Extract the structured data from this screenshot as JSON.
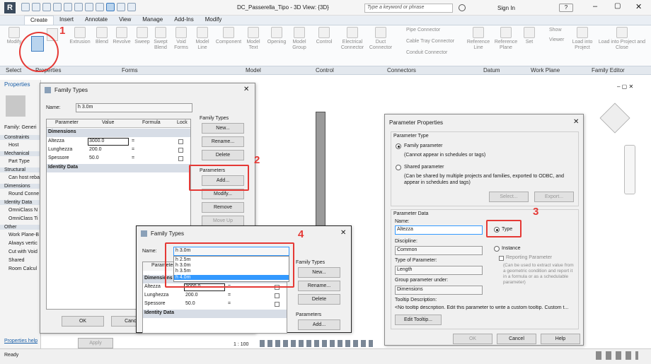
{
  "app": {
    "title": "DC_Passerella_Tipo - 3D View: {3D}",
    "search_placeholder": "Type a keyword or phrase",
    "sign_in": "Sign In"
  },
  "tabs": [
    "Create",
    "Insert",
    "Annotate",
    "View",
    "Manage",
    "Add-Ins",
    "Modify"
  ],
  "ribbon": {
    "tools": [
      "Modify",
      "Extrusion",
      "Blend",
      "Revolve",
      "Sweep",
      "Swept Blend",
      "Void Forms",
      "Model Line",
      "Component",
      "Model Text",
      "Opening",
      "Model Group",
      "Control",
      "Electrical Connector",
      "Duct Connector",
      "Pipe Connector",
      "Cable Tray Connector",
      "Conduit Connector",
      "Reference Line",
      "Reference Plane",
      "Set",
      "Show",
      "Viewer",
      "Load into Project",
      "Load into Project and Close"
    ],
    "panels": [
      "Select",
      "Properties",
      "Forms",
      "Model",
      "Control",
      "Connectors",
      "Datum",
      "Work Plane",
      "Family Editor"
    ]
  },
  "left_pane": {
    "title": "Properties",
    "items": [
      "Family: Generi",
      "Constraints",
      "Host",
      "Mechanical",
      "Part Type",
      "Structural",
      "Can host reba",
      "Dimensions",
      "Round Conne",
      "Identity Data",
      "OmniClass N",
      "OmniClass Ti",
      "Other",
      "Work Plane-B",
      "Always vertic",
      "Cut with Void",
      "Shared",
      "Room Calcul"
    ],
    "help": "Properties help",
    "apply": "Apply"
  },
  "family_types_1": {
    "title": "Family Types",
    "name_label": "Name:",
    "name_value": "h 3.0m",
    "cols": [
      "Parameter",
      "Value",
      "Formula",
      "Lock"
    ],
    "section_dim": "Dimensions",
    "section_id": "Identity Data",
    "rows": [
      {
        "p": "Altezza",
        "v": "3000.0",
        "f": "="
      },
      {
        "p": "Lunghezza",
        "v": "200.0",
        "f": "="
      },
      {
        "p": "Spessore",
        "v": "50.0",
        "f": "="
      }
    ],
    "ft_group": "Family Types",
    "ft_buttons": [
      "New...",
      "Rename...",
      "Delete"
    ],
    "param_group": "Parameters",
    "param_buttons": [
      "Add...",
      "Modify...",
      "Remove",
      "Move Up"
    ],
    "ok": "OK",
    "cancel": "Cancel"
  },
  "family_types_2": {
    "title": "Family Types",
    "name_label": "Name:",
    "name_value": "h 3.0m",
    "options": [
      "h 2.5m",
      "h 3.0m",
      "h 3.5m",
      "h 4.0m"
    ],
    "selected": "h 4.0m",
    "col": "Parameter",
    "section_dim": "Dimensions",
    "section_id": "Identity Data",
    "rows": [
      {
        "p": "Altezza",
        "v": "3000.0",
        "f": "="
      },
      {
        "p": "Lunghezza",
        "v": "200.0",
        "f": "="
      },
      {
        "p": "Spessore",
        "v": "50.0",
        "f": "="
      }
    ],
    "ft_group": "Family Types",
    "ft_buttons": [
      "New...",
      "Rename...",
      "Delete"
    ],
    "param_group": "Parameters",
    "param_add": "Add..."
  },
  "param_props": {
    "title": "Parameter Properties",
    "type_group": "Parameter Type",
    "family_param": "Family parameter",
    "family_note": "(Cannot appear in schedules or tags)",
    "shared_param": "Shared parameter",
    "shared_note": "(Can be shared by multiple projects and families, exported to ODBC, and appear in schedules and tags)",
    "select_btn": "Select...",
    "export_btn": "Export...",
    "data_group": "Parameter Data",
    "name_label": "Name:",
    "name_value": "Altezza",
    "type_radio": "Type",
    "instance_radio": "Instance",
    "discipline_label": "Discipline:",
    "discipline_value": "Common",
    "reporting": "Reporting Parameter",
    "reporting_note": "(Can be used to extract value from a geometric condition and report it in a formula or as a schedulable parameter)",
    "ptype_label": "Type of Parameter:",
    "ptype_value": "Length",
    "group_label": "Group parameter under:",
    "group_value": "Dimensions",
    "tooltip_label": "Tooltip Description:",
    "tooltip_value": "<No tooltip description. Edit this parameter to write a custom tooltip. Custom t...",
    "edit_tooltip": "Edit Tooltip...",
    "ok": "OK",
    "cancel": "Cancel",
    "help": "Help"
  },
  "annotations": [
    "1",
    "2",
    "3",
    "4"
  ],
  "status": {
    "ready": "Ready",
    "scale": "1 : 100"
  },
  "colors": {
    "accent": "#e53935",
    "selection": "#3399ff"
  }
}
